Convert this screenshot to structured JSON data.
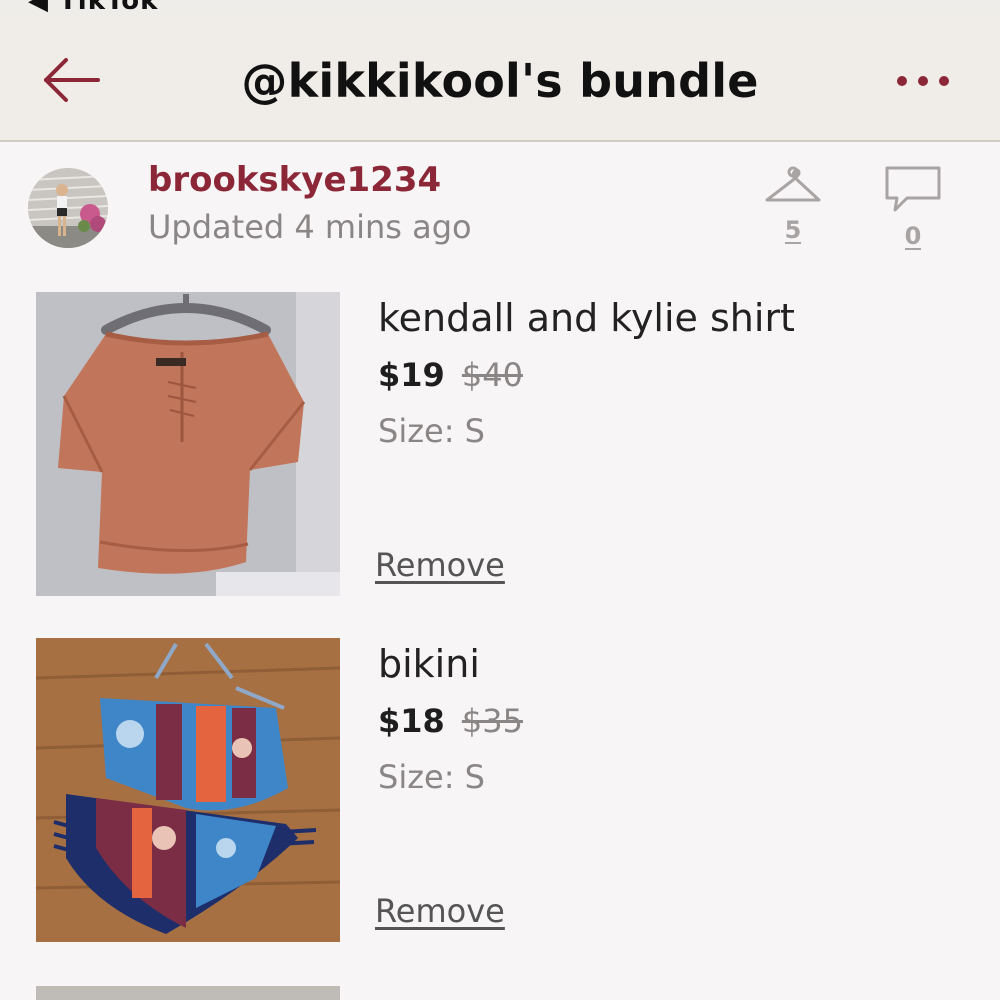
{
  "status_bar": {
    "back_app_label": "◀ TikTok"
  },
  "header": {
    "title": "@kikkikool's bundle"
  },
  "user": {
    "username": "brookskye1234",
    "updated": "Updated 4 mins ago",
    "likes_count": "5",
    "comments_count": "0"
  },
  "colors": {
    "accent": "#8b2737",
    "header_bg": "#f0ede9",
    "muted": "#8a8686"
  },
  "icons": [
    "back-arrow-icon",
    "more-dots-icon",
    "hanger-icon",
    "comment-icon"
  ],
  "items": [
    {
      "title": "kendall and kylie shirt",
      "price": "$19",
      "original_price": "$40",
      "size": "Size: S",
      "remove_label": "Remove"
    },
    {
      "title": "bikini",
      "price": "$18",
      "original_price": "$35",
      "size": "Size: S",
      "remove_label": "Remove"
    }
  ]
}
